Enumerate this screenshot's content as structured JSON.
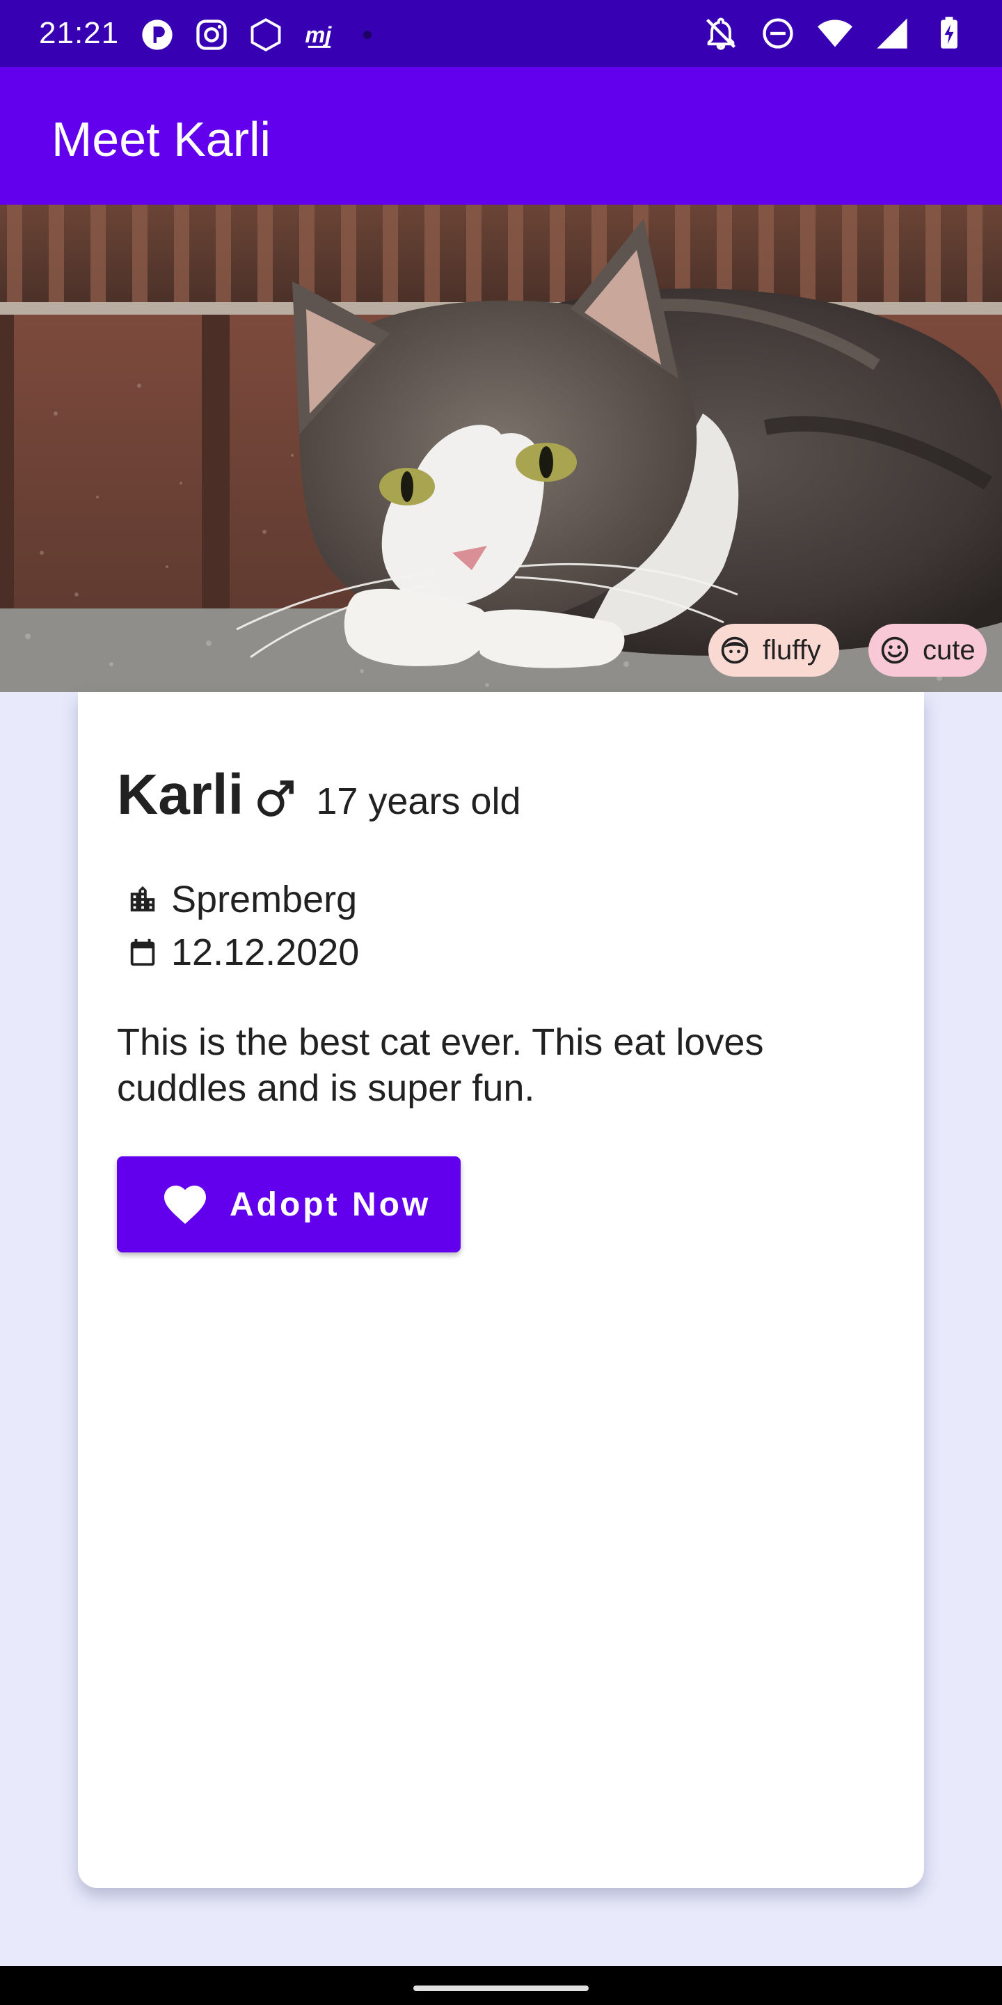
{
  "status_bar": {
    "time": "21:21",
    "left_icons": [
      "app-notification-icon",
      "instagram-icon",
      "hexagon-app-icon",
      "mj-app-icon",
      "more-notifications-dot"
    ],
    "right_icons": [
      "notifications-muted-icon",
      "do-not-disturb-icon",
      "wifi-icon",
      "cellular-signal-icon",
      "battery-charging-icon"
    ],
    "mj_glyph": "mj"
  },
  "app_bar": {
    "title": "Meet Karli",
    "color": "#6200EE",
    "status_color": "#3700B3"
  },
  "hero": {
    "tags": [
      {
        "label": "fluffy",
        "icon": "face-icon",
        "color": "#FAD9D3"
      },
      {
        "label": "cute",
        "icon": "smiley-icon",
        "color": "#F9C8D6"
      }
    ]
  },
  "pet": {
    "name": "Karli",
    "gender_icon": "male-icon",
    "age": "17 years old",
    "location": "Spremberg",
    "location_icon": "city-icon",
    "date": "12.12.2020",
    "date_icon": "calendar-icon",
    "description": "This is the best cat ever. This eat loves cuddles and is super fun."
  },
  "actions": {
    "adopt_label": "Adopt Now",
    "adopt_icon": "heart-icon"
  },
  "theme": {
    "background": "#E8EAFB",
    "card": "#FFFFFF",
    "primary": "#6200EE"
  }
}
